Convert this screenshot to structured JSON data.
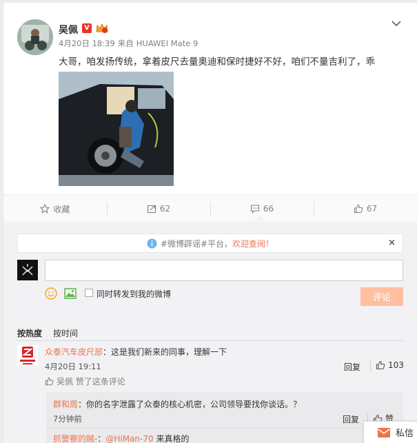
{
  "post": {
    "user_name": "吴佩",
    "verified_badge": "V",
    "vip_icon": "vip-crown-icon",
    "time": "4月20日 18:39",
    "source_prefix": "来自",
    "source": "HUAWEI Mate 9",
    "text": "大哥，咱发扬传统，拿着皮尺去量奥迪和保时捷好不好，咱们不量吉利了，乖"
  },
  "actions": {
    "favorite_label": "收藏",
    "repost_count": "62",
    "comment_count": "66",
    "like_count": "67"
  },
  "notice": {
    "text": "#微博辟谣#平台，",
    "link": "欢迎查阅！",
    "close": "×"
  },
  "composer": {
    "input_value": "",
    "repost_label": "同时转发到我的微博",
    "submit_label": "评论"
  },
  "sort": {
    "by_hot": "按热度",
    "by_time": "按时间"
  },
  "comment": {
    "author": "众泰汽车皮尺部",
    "text": "：这是我们新来的同事，理解一下",
    "time": "4月20日 19:11",
    "reply_label": "回复",
    "like_count": "103",
    "liked_by_user": "吴佩",
    "liked_by_suffix": "赞了这条评论"
  },
  "replies": [
    {
      "author": "群和周",
      "text": "：你的名字泄露了众泰的核心机密，公司领导要找你谈话。？",
      "time": "7分钟前",
      "reply_label": "回复",
      "like_label": "赞"
    },
    {
      "author": "抓警察的贼-",
      "text_prefix": "：",
      "mention": "@HiMan-70",
      "text": " 来真格的"
    }
  ],
  "dm": {
    "label": "私信"
  },
  "colors": {
    "accent": "#eb7350",
    "submit_bg": "#ffc09f",
    "verified": "#e8332b"
  }
}
